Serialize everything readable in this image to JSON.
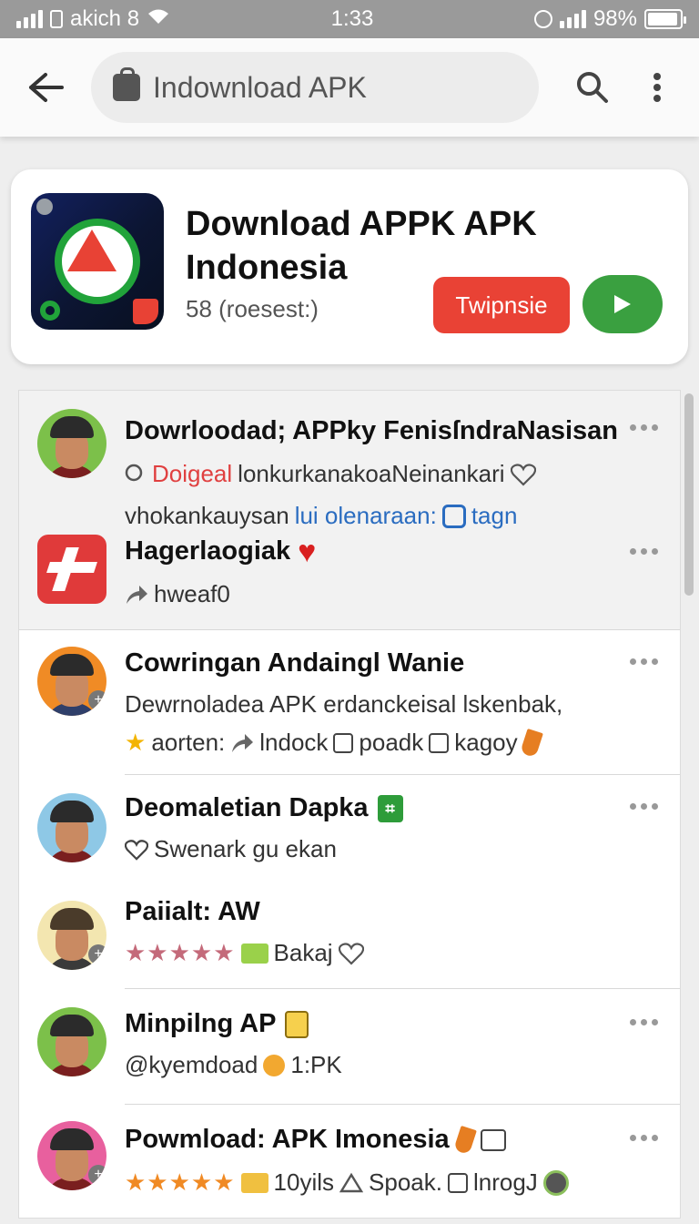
{
  "status_bar": {
    "carrier": "akich 8",
    "time": "1:33",
    "battery": "98%"
  },
  "toolbar": {
    "search_value": "Indownload APK"
  },
  "app_card": {
    "title": "Download APPK APK Indonesia",
    "subtitle": "58 (roesest:)",
    "primary_button": "Twipnsie",
    "colors": {
      "primary": "#e94235",
      "play": "#3aa040"
    }
  },
  "list": [
    {
      "title": "Dowrloodad; APPky FenisſndraNasisan",
      "line1_highlight": "Doigeal",
      "line1_text": "lonkurkanakoaNeinankari",
      "line2_text": "vhokankauysan",
      "line2_link": "lui olenaraan:",
      "line2_tag": "tagn"
    },
    {
      "title": "Hagerlaogiak",
      "line1_text": "hweaf0"
    },
    {
      "title": "Cowringan Andaingl Wanie",
      "line1_text": "Dewrnoladea APK erdanckeisal lskenbak,",
      "line2_a": "aorten:",
      "line2_b": "lndock",
      "line2_c": "poadk",
      "line2_d": "kagoy"
    },
    {
      "title": "Deomaletian Dapka",
      "line1_text": "Swenark gu ekan"
    },
    {
      "title": "Paiialt: AW",
      "stars": "★★★★★",
      "line1_text": "Bakaj"
    },
    {
      "title": "Minpilng AP",
      "line1_text": "@kyemdoad",
      "line1_b": "1:PK"
    },
    {
      "title": "Powmload: APK Imonesia",
      "stars": "★★★★★",
      "line1_a": "10yils",
      "line1_b": "Spoak.",
      "line1_c": "lnrogJ"
    }
  ]
}
